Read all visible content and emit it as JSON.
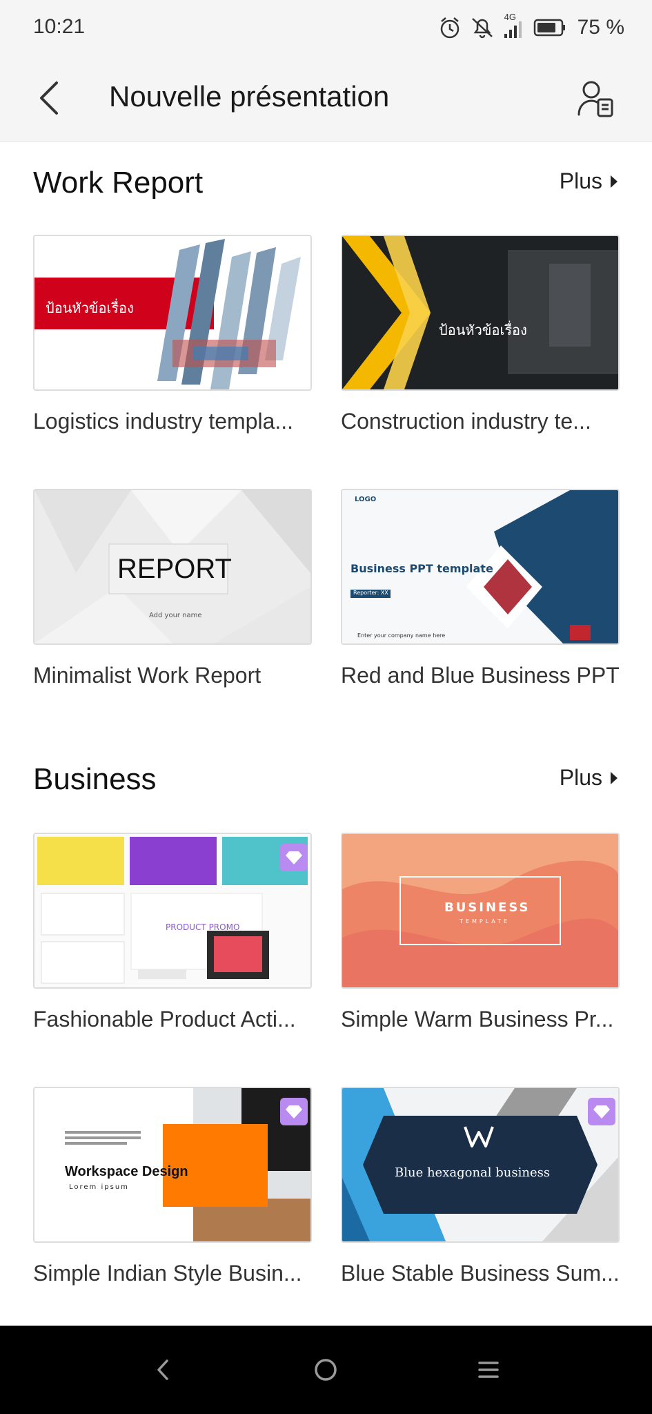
{
  "status": {
    "time": "10:21",
    "network": "4G",
    "battery": "75 %"
  },
  "header": {
    "title": "Nouvelle présentation"
  },
  "sections": [
    {
      "title": "Work Report",
      "more_label": "Plus",
      "items": [
        {
          "label": "Logistics industry templa...",
          "thumb_title": "ป้อนหัวข้อเรื่อง"
        },
        {
          "label": "Construction industry te...",
          "thumb_title": "ป้อนหัวข้อเรื่อง"
        },
        {
          "label": "Minimalist Work Report",
          "thumb_title": "REPORT",
          "thumb_sub": "Add your name"
        },
        {
          "label": "Red and Blue Business PPT",
          "thumb_title": "Business PPT template",
          "thumb_logo": "LOGO",
          "thumb_reporter": "Reporter: XX",
          "thumb_footer": "Enter your company name here"
        }
      ]
    },
    {
      "title": "Business",
      "more_label": "Plus",
      "items": [
        {
          "label": "Fashionable Product Acti...",
          "thumb_title": "PRODUCT PROMO"
        },
        {
          "label": "Simple Warm Business Pr...",
          "thumb_title": "BUSINESS",
          "thumb_sub": "TEMPLATE"
        },
        {
          "label": "Simple Indian Style Busin...",
          "thumb_title": "Workspace Design",
          "thumb_sub": "Lorem ipsum"
        },
        {
          "label": "Blue Stable Business Sum...",
          "thumb_title": "Blue hexagonal business"
        }
      ]
    }
  ],
  "colors": {
    "premium_badge": "#b98af0",
    "accent_red": "#d0021b",
    "accent_yellow": "#f5b800",
    "accent_navy": "#1d4a70"
  }
}
